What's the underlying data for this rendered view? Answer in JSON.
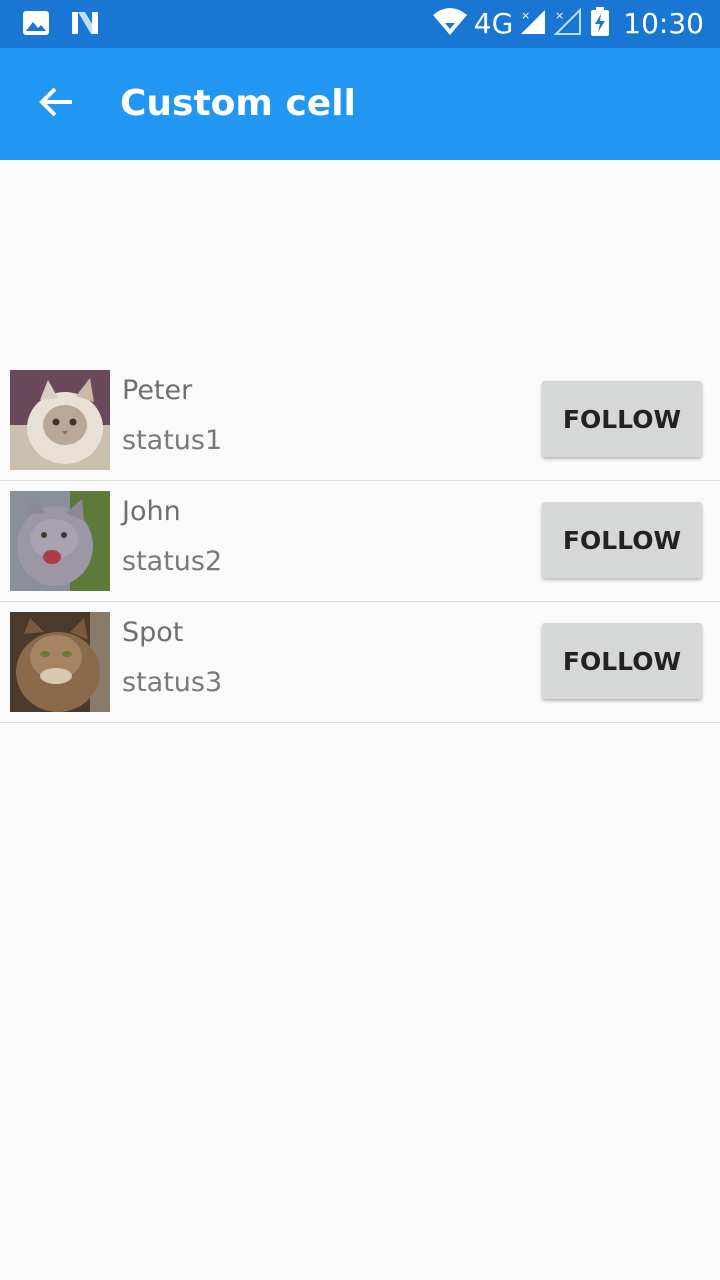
{
  "status_bar": {
    "time": "10:30",
    "network": "4G"
  },
  "app_bar": {
    "title": "Custom cell",
    "color": "#2196f3"
  },
  "contacts": [
    {
      "name": "Peter",
      "status": "status1",
      "action": "FOLLOW"
    },
    {
      "name": "John",
      "status": "status2",
      "action": "FOLLOW"
    },
    {
      "name": "Spot",
      "status": "status3",
      "action": "FOLLOW"
    }
  ]
}
